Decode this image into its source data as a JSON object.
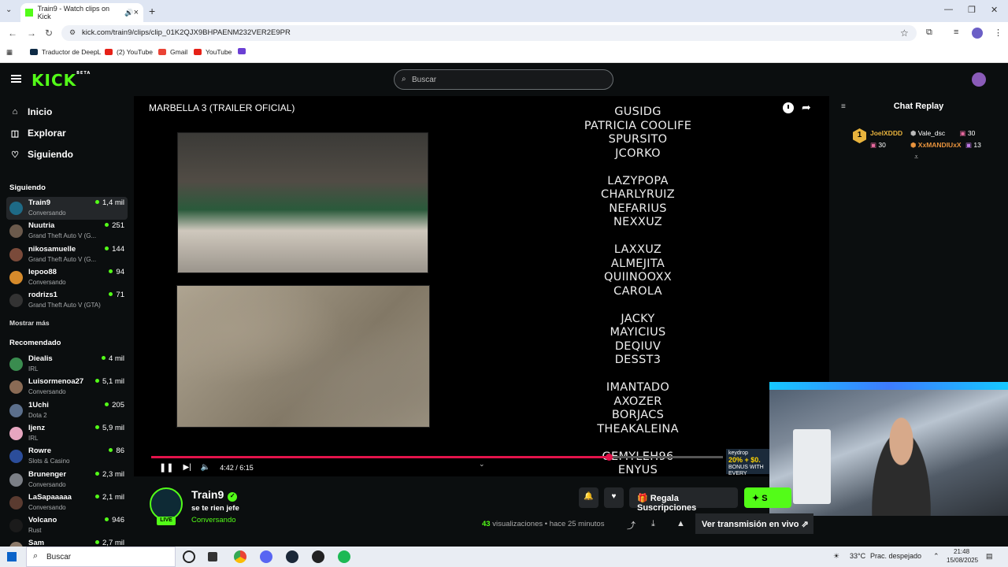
{
  "browser": {
    "tab_title": "Train9 - Watch clips on Kick",
    "url": "kick.com/train9/clips/clip_01K2QJX9BHPAENM232VER2E9PR",
    "bookmarks": [
      "Traductor de DeepL",
      "(2) YouTube",
      "Gmail",
      "YouTube"
    ]
  },
  "kick": {
    "search_placeholder": "Buscar",
    "logo": "KICK",
    "logo_beta": "BETA"
  },
  "sidebar": {
    "nav": [
      {
        "label": "Inicio",
        "icon": "home-icon"
      },
      {
        "label": "Explorar",
        "icon": "compass-icon"
      },
      {
        "label": "Siguiendo",
        "icon": "heart-icon"
      }
    ],
    "following_title": "Siguiendo",
    "following": [
      {
        "name": "Train9",
        "category": "Conversando",
        "viewers": "1,4 mil",
        "color": "#1e6a86"
      },
      {
        "name": "Nuutria",
        "category": "Grand Theft Auto V (G...",
        "viewers": "251",
        "color": "#6b5a4c"
      },
      {
        "name": "nikosamuelle",
        "category": "Grand Theft Auto V (G...",
        "viewers": "144",
        "color": "#7a4a3a"
      },
      {
        "name": "lepoo88",
        "category": "Conversando",
        "viewers": "94",
        "color": "#d58a2b"
      },
      {
        "name": "rodrizs1",
        "category": "Grand Theft Auto V (GTA)",
        "viewers": "71",
        "color": "#333333"
      }
    ],
    "show_more": "Mostrar más",
    "recommended_title": "Recomendado",
    "recommended": [
      {
        "name": "Diealis",
        "category": "IRL",
        "viewers": "4 mil",
        "color": "#3a8c4f"
      },
      {
        "name": "Luisormenoa27",
        "category": "Conversando",
        "viewers": "5,1 mil",
        "color": "#8a6b55"
      },
      {
        "name": "1Uchi",
        "category": "Dota 2",
        "viewers": "205",
        "color": "#5b6f8c"
      },
      {
        "name": "Ijenz",
        "category": "IRL",
        "viewers": "5,9 mil",
        "color": "#e6a6c0"
      },
      {
        "name": "Rowre",
        "category": "Slots & Casino",
        "viewers": "86",
        "color": "#2b4d9a"
      },
      {
        "name": "Brunenger",
        "category": "Conversando",
        "viewers": "2,3 mil",
        "color": "#7b7f86"
      },
      {
        "name": "LaSapaaaaa",
        "category": "Conversando",
        "viewers": "2,1 mil",
        "color": "#5a3b30"
      },
      {
        "name": "Volcano",
        "category": "Rust",
        "viewers": "946",
        "color": "#1b1b1b"
      },
      {
        "name": "Sam",
        "category": "",
        "viewers": "2,7 mil",
        "color": "#8c7a6a"
      }
    ]
  },
  "player": {
    "title": "MARBELLA 3 (TRAILER OFICIAL)",
    "credits": [
      [
        "GUSIDG",
        "PATRICIA COOLIFE",
        "SPURSITO",
        "JCORKO"
      ],
      [
        "LAZYPOPA",
        "CHARLYRUIZ",
        "NEFARIUS",
        "NEXXUZ"
      ],
      [
        "LAXXUZ",
        "ALMEJITA",
        "QUIINOOXX",
        "CAROLA"
      ],
      [
        "JACKY",
        "MAYICIUS",
        "DEQIUV",
        "DESST3"
      ],
      [
        "IMANTADO",
        "AXOZER",
        "BORJACS",
        "THEAKALEINA"
      ],
      [
        "GEMYLEH96",
        "ENYUS"
      ]
    ],
    "time": "4:42 / 6:15",
    "progress": 0.8,
    "ad_brand": "keydrop",
    "ad_offer": "20% + $0.",
    "ad_text": "BONUS WITH EVERY"
  },
  "chat": {
    "title": "Chat Replay",
    "top_rank": "1",
    "leaders_left": [
      {
        "name": "JoelXDDD",
        "count": "30"
      }
    ],
    "leaders_right": [
      {
        "name": "Vale_dsc",
        "count": "30"
      },
      {
        "name": "XxMANDIUxX",
        "count": "13"
      }
    ]
  },
  "channel": {
    "name": "Train9",
    "stream_title": "se te rien jefe",
    "category": "Conversando",
    "live_badge": "LIVE",
    "gift_label": "Regala Suscripciones",
    "sub_label": "S",
    "views": "43",
    "views_label": "visualizaciones",
    "ago": "hace 25 minutos",
    "watch_live": "Ver transmisión en vivo"
  },
  "taskbar": {
    "search": "Buscar",
    "temp": "33°C",
    "weather": "Prac. despejado",
    "time": "21:48",
    "date": "15/08/2025"
  }
}
